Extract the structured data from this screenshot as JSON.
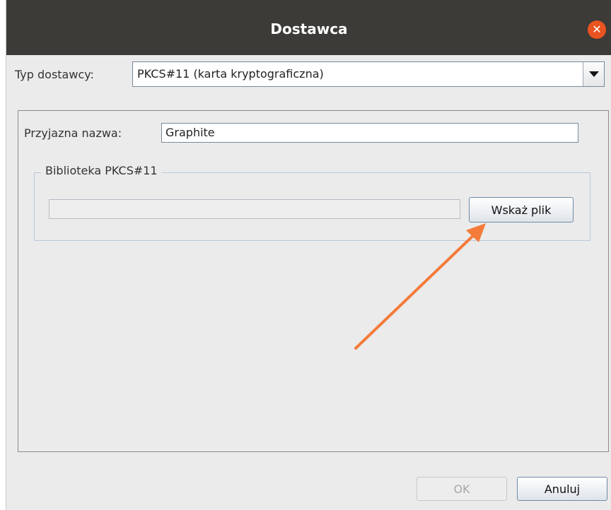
{
  "window": {
    "title": "Dostawca",
    "close_symbol": "✕"
  },
  "provider_type": {
    "label": "Typ dostawcy:",
    "selected": "PKCS#11 (karta kryptograficzna)"
  },
  "friendly_name": {
    "label": "Przyjazna nazwa:",
    "value": "Graphite"
  },
  "library": {
    "group_title": "Biblioteka PKCS#11",
    "path_value": "",
    "browse_label": "Wskaż plik"
  },
  "footer": {
    "ok_label": "OK",
    "cancel_label": "Anuluj"
  },
  "annotation": {
    "arrow_color": "#f47b3a"
  },
  "colors": {
    "titlebar": "#3c3b37",
    "close_button": "#e95420",
    "background": "#ebebeb"
  }
}
